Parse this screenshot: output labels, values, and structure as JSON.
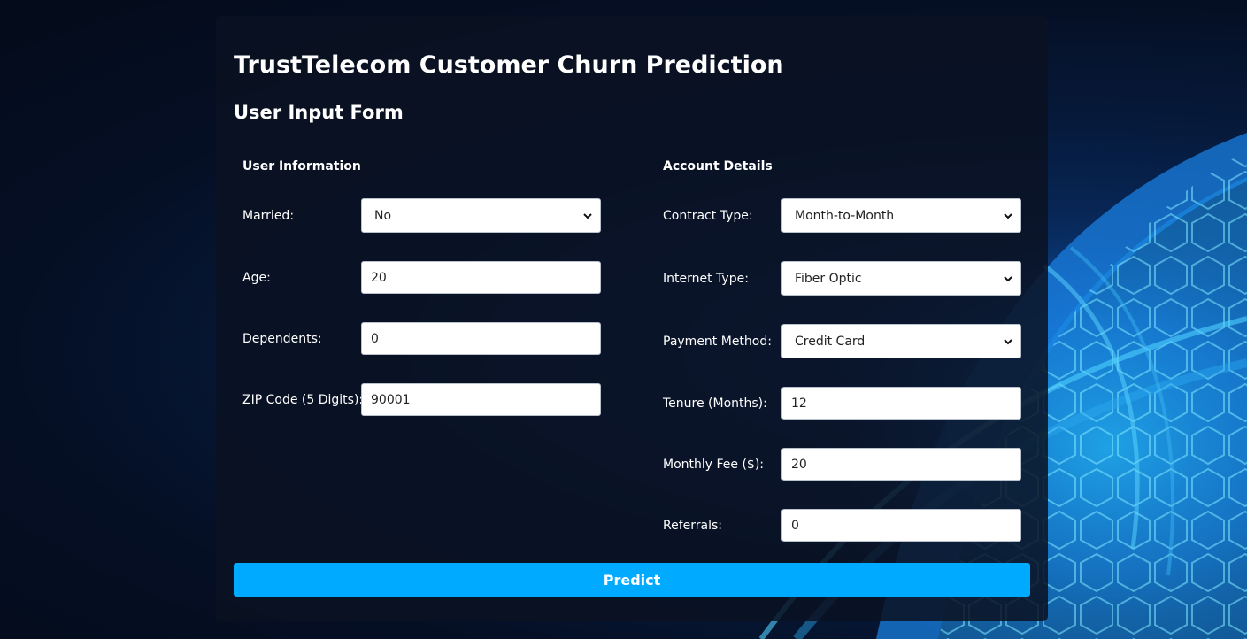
{
  "page": {
    "title": "TrustTelecom Customer Churn Prediction",
    "form_title": "User Input Form"
  },
  "user_info": {
    "heading": "User Information",
    "married_label": "Married:",
    "married_value": "No",
    "age_label": "Age:",
    "age_value": "20",
    "dependents_label": "Dependents:",
    "dependents_value": "0",
    "zip_label": "ZIP Code (5 Digits):",
    "zip_value": "90001"
  },
  "account": {
    "heading": "Account Details",
    "contract_label": "Contract Type:",
    "contract_value": "Month-to-Month",
    "internet_label": "Internet Type:",
    "internet_value": "Fiber Optic",
    "payment_label": "Payment Method:",
    "payment_value": "Credit Card",
    "tenure_label": "Tenure (Months):",
    "tenure_value": "12",
    "fee_label": "Monthly Fee ($):",
    "fee_value": "20",
    "referrals_label": "Referrals:",
    "referrals_value": "0"
  },
  "actions": {
    "predict_label": "Predict"
  },
  "colors": {
    "accent": "#00aaff",
    "card_bg": "#0a1222",
    "page_bg": "#040b1a",
    "text": "#ffffff"
  },
  "icons": {
    "select_arrow": "chevron-down-icon"
  }
}
